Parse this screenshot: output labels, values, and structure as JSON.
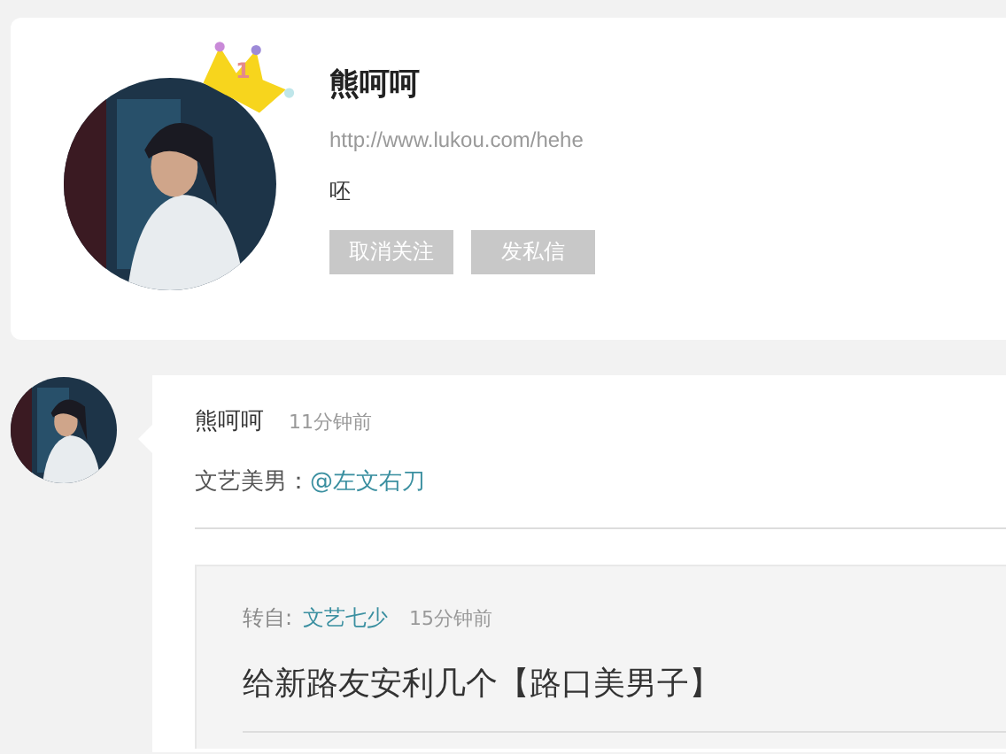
{
  "profile": {
    "name": "熊呵呵",
    "crown_badge": "1",
    "url": "http://www.lukou.com/hehe",
    "bio": "呸",
    "buttons": [
      {
        "label": "取消关注"
      },
      {
        "label": "发私信"
      }
    ]
  },
  "post": {
    "author": "熊呵呵",
    "time": "11分钟前",
    "text": "文艺美男：",
    "mention": "@左文右刀",
    "repost": {
      "label": "转自:",
      "source": "文艺七少",
      "time": "15分钟前",
      "title": "给新路友安利几个【路口美男子】"
    }
  }
}
